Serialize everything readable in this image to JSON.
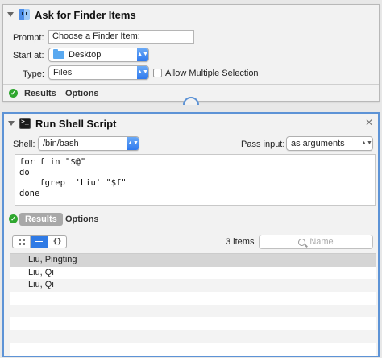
{
  "ask_panel": {
    "title": "Ask for Finder Items",
    "prompt_label": "Prompt:",
    "prompt_value": "Choose a Finder Item:",
    "start_label": "Start at:",
    "start_value": "Desktop",
    "type_label": "Type:",
    "type_value": "Files",
    "allow_multiple_label": "Allow Multiple Selection",
    "allow_multiple_checked": false,
    "results_tab": "Results",
    "options_tab": "Options"
  },
  "shell_panel": {
    "title": "Run Shell Script",
    "shell_label": "Shell:",
    "shell_value": "/bin/bash",
    "pass_input_label": "Pass input:",
    "pass_input_value": "as arguments",
    "script": "for f in \"$@\"\ndo\n    fgrep  'Liu' \"$f\"\ndone",
    "results_tab": "Results",
    "options_tab": "Options",
    "view_json_label": "{}",
    "items_count": "3 items",
    "search_placeholder": "Name",
    "rows": [
      {
        "text": "Liu, Pingting",
        "selected": true
      },
      {
        "text": "Liu, Qi",
        "selected": false
      },
      {
        "text": "Liu, Qi",
        "selected": false
      },
      {
        "text": "",
        "selected": false
      },
      {
        "text": "",
        "selected": false
      },
      {
        "text": "",
        "selected": false
      },
      {
        "text": "",
        "selected": false
      },
      {
        "text": "",
        "selected": false
      }
    ]
  },
  "colors": {
    "accent": "#2f7ae5",
    "selection_border": "#5d93d6",
    "status_ok": "#2fa72f"
  }
}
